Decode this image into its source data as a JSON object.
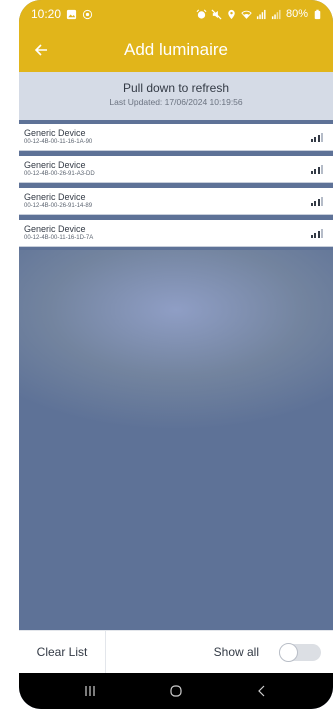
{
  "status_bar": {
    "time": "10:20",
    "battery": "80%"
  },
  "app_bar": {
    "title": "Add luminaire"
  },
  "refresh": {
    "title": "Pull down to refresh",
    "last_updated": "Last Updated: 17/06/2024 10:19:56"
  },
  "devices": [
    {
      "name": "Generic Device",
      "address": "00-12-4B-00-11-16-1A-90",
      "signal_bars": 3
    },
    {
      "name": "Generic Device",
      "address": "00-12-4B-00-26-91-A3-DD",
      "signal_bars": 3
    },
    {
      "name": "Generic Device",
      "address": "00-12-4B-00-26-91-14-89",
      "signal_bars": 3
    },
    {
      "name": "Generic Device",
      "address": "00-12-4B-00-11-16-1D-7A",
      "signal_bars": 3
    }
  ],
  "bottom": {
    "clear_label": "Clear List",
    "show_all_label": "Show all",
    "show_all_on": false
  },
  "colors": {
    "accent": "#e1b51a",
    "background": "#5e7297",
    "banner": "#d5dbe6"
  }
}
